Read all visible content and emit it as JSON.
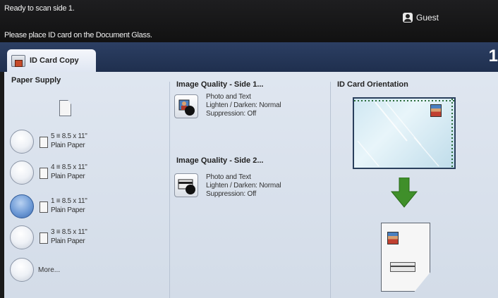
{
  "header": {
    "status_line1": "Ready to scan side 1.",
    "status_line2": "Please place ID card on the Document Glass.",
    "user_label": "Guest",
    "user_icon": "user-icon"
  },
  "tab": {
    "label": "ID Card Copy",
    "icon": "id-card-copy-icon",
    "page_indicator": "1"
  },
  "paper_supply": {
    "title": "Paper Supply",
    "trays": [
      {
        "tray": "5",
        "size": "8.5 x 11\"",
        "type": "Plain Paper",
        "selected": false
      },
      {
        "tray": "4",
        "size": "8.5 x 11\"",
        "type": "Plain Paper",
        "selected": false
      },
      {
        "tray": "1",
        "size": "8.5 x 11\"",
        "type": "Plain Paper",
        "selected": true
      },
      {
        "tray": "3",
        "size": "8.5 x 11\"",
        "type": "Plain Paper",
        "selected": false
      }
    ],
    "more_label": "More..."
  },
  "image_quality": {
    "side1": {
      "title": "Image Quality - Side 1...",
      "line1": "Photo and Text",
      "line2": "Lighten / Darken: Normal",
      "line3": "Suppression: Off"
    },
    "side2": {
      "title": "Image Quality - Side 2...",
      "line1": "Photo and Text",
      "line2": "Lighten / Darken: Normal",
      "line3": "Suppression: Off"
    }
  },
  "orientation": {
    "title": "ID Card Orientation"
  },
  "colors": {
    "tab_bar": "#243658",
    "selected_radio": "#4a78bb",
    "arrow": "#3f8f2a"
  }
}
